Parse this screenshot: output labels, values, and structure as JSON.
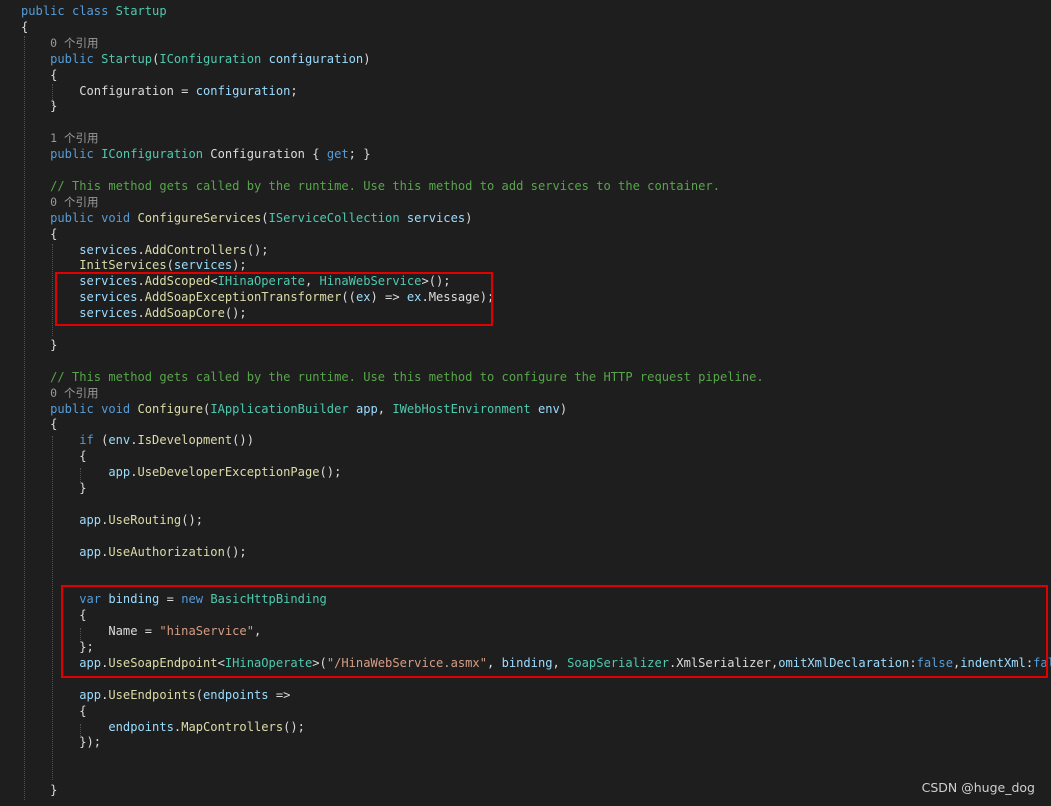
{
  "code_lines": [
    {
      "indent": "",
      "tokens": [
        {
          "t": "public",
          "c": "kw"
        },
        {
          "t": " ",
          "c": "pl"
        },
        {
          "t": "class",
          "c": "kw"
        },
        {
          "t": " ",
          "c": "pl"
        },
        {
          "t": "Startup",
          "c": "ty"
        }
      ]
    },
    {
      "indent": "",
      "tokens": [
        {
          "t": "{",
          "c": "pl"
        }
      ]
    },
    {
      "indent": "    ",
      "lens": "0 个引用"
    },
    {
      "indent": "    ",
      "tokens": [
        {
          "t": "public",
          "c": "kw"
        },
        {
          "t": " ",
          "c": "pl"
        },
        {
          "t": "Startup",
          "c": "ty"
        },
        {
          "t": "(",
          "c": "pl"
        },
        {
          "t": "IConfiguration",
          "c": "ty"
        },
        {
          "t": " ",
          "c": "pl"
        },
        {
          "t": "configuration",
          "c": "pa"
        },
        {
          "t": ")",
          "c": "pl"
        }
      ]
    },
    {
      "indent": "    ",
      "tokens": [
        {
          "t": "{",
          "c": "pl"
        }
      ]
    },
    {
      "indent": "        ",
      "tokens": [
        {
          "t": "Configuration",
          "c": "pl"
        },
        {
          "t": " = ",
          "c": "pl"
        },
        {
          "t": "configuration",
          "c": "pa"
        },
        {
          "t": ";",
          "c": "pl"
        }
      ]
    },
    {
      "indent": "    ",
      "tokens": [
        {
          "t": "}",
          "c": "pl"
        }
      ]
    },
    {
      "indent": "",
      "tokens": []
    },
    {
      "indent": "    ",
      "lens": "1 个引用"
    },
    {
      "indent": "    ",
      "tokens": [
        {
          "t": "public",
          "c": "kw"
        },
        {
          "t": " ",
          "c": "pl"
        },
        {
          "t": "IConfiguration",
          "c": "ty"
        },
        {
          "t": " Configuration { ",
          "c": "pl"
        },
        {
          "t": "get",
          "c": "kw"
        },
        {
          "t": "; }",
          "c": "pl"
        }
      ]
    },
    {
      "indent": "",
      "tokens": []
    },
    {
      "indent": "    ",
      "tokens": [
        {
          "t": "// This method gets called by the runtime. Use this method to add services to the container.",
          "c": "cm"
        }
      ]
    },
    {
      "indent": "    ",
      "lens": "0 个引用"
    },
    {
      "indent": "    ",
      "tokens": [
        {
          "t": "public",
          "c": "kw"
        },
        {
          "t": " ",
          "c": "pl"
        },
        {
          "t": "void",
          "c": "kw"
        },
        {
          "t": " ",
          "c": "pl"
        },
        {
          "t": "ConfigureServices",
          "c": "me"
        },
        {
          "t": "(",
          "c": "pl"
        },
        {
          "t": "IServiceCollection",
          "c": "ty"
        },
        {
          "t": " ",
          "c": "pl"
        },
        {
          "t": "services",
          "c": "pa"
        },
        {
          "t": ")",
          "c": "pl"
        }
      ]
    },
    {
      "indent": "    ",
      "tokens": [
        {
          "t": "{",
          "c": "pl"
        }
      ]
    },
    {
      "indent": "        ",
      "tokens": [
        {
          "t": "services",
          "c": "pa"
        },
        {
          "t": ".",
          "c": "pl"
        },
        {
          "t": "AddControllers",
          "c": "me"
        },
        {
          "t": "();",
          "c": "pl"
        }
      ]
    },
    {
      "indent": "        ",
      "tokens": [
        {
          "t": "InitServices",
          "c": "me"
        },
        {
          "t": "(",
          "c": "pl"
        },
        {
          "t": "services",
          "c": "pa"
        },
        {
          "t": ");",
          "c": "pl"
        }
      ]
    },
    {
      "indent": "        ",
      "tokens": [
        {
          "t": "services",
          "c": "pa"
        },
        {
          "t": ".",
          "c": "pl"
        },
        {
          "t": "AddScoped",
          "c": "me"
        },
        {
          "t": "<",
          "c": "pl"
        },
        {
          "t": "IHinaOperate",
          "c": "ty"
        },
        {
          "t": ", ",
          "c": "pl"
        },
        {
          "t": "HinaWebService",
          "c": "ty"
        },
        {
          "t": ">();",
          "c": "pl"
        }
      ]
    },
    {
      "indent": "        ",
      "tokens": [
        {
          "t": "services",
          "c": "pa"
        },
        {
          "t": ".",
          "c": "pl"
        },
        {
          "t": "AddSoapExceptionTransformer",
          "c": "me"
        },
        {
          "t": "((",
          "c": "pl"
        },
        {
          "t": "ex",
          "c": "pa"
        },
        {
          "t": ") => ",
          "c": "pl"
        },
        {
          "t": "ex",
          "c": "pa"
        },
        {
          "t": ".Message);",
          "c": "pl"
        }
      ]
    },
    {
      "indent": "        ",
      "tokens": [
        {
          "t": "services",
          "c": "pa"
        },
        {
          "t": ".",
          "c": "pl"
        },
        {
          "t": "AddSoapCore",
          "c": "me"
        },
        {
          "t": "();",
          "c": "pl"
        }
      ]
    },
    {
      "indent": "",
      "tokens": []
    },
    {
      "indent": "    ",
      "tokens": [
        {
          "t": "}",
          "c": "pl"
        }
      ]
    },
    {
      "indent": "",
      "tokens": []
    },
    {
      "indent": "    ",
      "tokens": [
        {
          "t": "// This method gets called by the runtime. Use this method to configure the HTTP request pipeline.",
          "c": "cm"
        }
      ]
    },
    {
      "indent": "    ",
      "lens": "0 个引用"
    },
    {
      "indent": "    ",
      "tokens": [
        {
          "t": "public",
          "c": "kw"
        },
        {
          "t": " ",
          "c": "pl"
        },
        {
          "t": "void",
          "c": "kw"
        },
        {
          "t": " ",
          "c": "pl"
        },
        {
          "t": "Configure",
          "c": "me"
        },
        {
          "t": "(",
          "c": "pl"
        },
        {
          "t": "IApplicationBuilder",
          "c": "ty"
        },
        {
          "t": " ",
          "c": "pl"
        },
        {
          "t": "app",
          "c": "pa"
        },
        {
          "t": ", ",
          "c": "pl"
        },
        {
          "t": "IWebHostEnvironment",
          "c": "ty"
        },
        {
          "t": " ",
          "c": "pl"
        },
        {
          "t": "env",
          "c": "pa"
        },
        {
          "t": ")",
          "c": "pl"
        }
      ]
    },
    {
      "indent": "    ",
      "tokens": [
        {
          "t": "{",
          "c": "pl"
        }
      ]
    },
    {
      "indent": "        ",
      "tokens": [
        {
          "t": "if",
          "c": "kw"
        },
        {
          "t": " (",
          "c": "pl"
        },
        {
          "t": "env",
          "c": "pa"
        },
        {
          "t": ".",
          "c": "pl"
        },
        {
          "t": "IsDevelopment",
          "c": "me"
        },
        {
          "t": "())",
          "c": "pl"
        }
      ]
    },
    {
      "indent": "        ",
      "tokens": [
        {
          "t": "{",
          "c": "pl"
        }
      ]
    },
    {
      "indent": "            ",
      "tokens": [
        {
          "t": "app",
          "c": "pa"
        },
        {
          "t": ".",
          "c": "pl"
        },
        {
          "t": "UseDeveloperExceptionPage",
          "c": "me"
        },
        {
          "t": "();",
          "c": "pl"
        }
      ]
    },
    {
      "indent": "        ",
      "tokens": [
        {
          "t": "}",
          "c": "pl"
        }
      ]
    },
    {
      "indent": "",
      "tokens": []
    },
    {
      "indent": "        ",
      "tokens": [
        {
          "t": "app",
          "c": "pa"
        },
        {
          "t": ".",
          "c": "pl"
        },
        {
          "t": "UseRouting",
          "c": "me"
        },
        {
          "t": "();",
          "c": "pl"
        }
      ]
    },
    {
      "indent": "",
      "tokens": []
    },
    {
      "indent": "        ",
      "tokens": [
        {
          "t": "app",
          "c": "pa"
        },
        {
          "t": ".",
          "c": "pl"
        },
        {
          "t": "UseAuthorization",
          "c": "me"
        },
        {
          "t": "();",
          "c": "pl"
        }
      ]
    },
    {
      "indent": "",
      "tokens": []
    },
    {
      "indent": "",
      "tokens": []
    },
    {
      "indent": "        ",
      "tokens": [
        {
          "t": "var",
          "c": "kw"
        },
        {
          "t": " ",
          "c": "pl"
        },
        {
          "t": "binding",
          "c": "pa"
        },
        {
          "t": " = ",
          "c": "pl"
        },
        {
          "t": "new",
          "c": "kw"
        },
        {
          "t": " ",
          "c": "pl"
        },
        {
          "t": "BasicHttpBinding",
          "c": "ty"
        }
      ]
    },
    {
      "indent": "        ",
      "tokens": [
        {
          "t": "{",
          "c": "pl"
        }
      ]
    },
    {
      "indent": "            ",
      "tokens": [
        {
          "t": "Name = ",
          "c": "pl"
        },
        {
          "t": "\"hinaService\"",
          "c": "st"
        },
        {
          "t": ",",
          "c": "pl"
        }
      ]
    },
    {
      "indent": "        ",
      "tokens": [
        {
          "t": "};",
          "c": "pl"
        }
      ]
    },
    {
      "indent": "        ",
      "tokens": [
        {
          "t": "app",
          "c": "pa"
        },
        {
          "t": ".",
          "c": "pl"
        },
        {
          "t": "UseSoapEndpoint",
          "c": "me"
        },
        {
          "t": "<",
          "c": "pl"
        },
        {
          "t": "IHinaOperate",
          "c": "ty"
        },
        {
          "t": ">(",
          "c": "pl"
        },
        {
          "t": "\"/HinaWebService.asmx\"",
          "c": "st"
        },
        {
          "t": ", ",
          "c": "pl"
        },
        {
          "t": "binding",
          "c": "pa"
        },
        {
          "t": ", ",
          "c": "pl"
        },
        {
          "t": "SoapSerializer",
          "c": "ty"
        },
        {
          "t": ".XmlSerializer,",
          "c": "pl"
        },
        {
          "t": "omitXmlDeclaration",
          "c": "pa"
        },
        {
          "t": ":",
          "c": "pl"
        },
        {
          "t": "false",
          "c": "kw"
        },
        {
          "t": ",",
          "c": "pl"
        },
        {
          "t": "indentXml",
          "c": "pa"
        },
        {
          "t": ":",
          "c": "pl"
        },
        {
          "t": "false",
          "c": "kw"
        },
        {
          "t": ");",
          "c": "pl"
        }
      ]
    },
    {
      "indent": "",
      "tokens": []
    },
    {
      "indent": "        ",
      "tokens": [
        {
          "t": "app",
          "c": "pa"
        },
        {
          "t": ".",
          "c": "pl"
        },
        {
          "t": "UseEndpoints",
          "c": "me"
        },
        {
          "t": "(",
          "c": "pl"
        },
        {
          "t": "endpoints",
          "c": "pa"
        },
        {
          "t": " =>",
          "c": "pl"
        }
      ]
    },
    {
      "indent": "        ",
      "tokens": [
        {
          "t": "{",
          "c": "pl"
        }
      ]
    },
    {
      "indent": "            ",
      "tokens": [
        {
          "t": "endpoints",
          "c": "pa"
        },
        {
          "t": ".",
          "c": "pl"
        },
        {
          "t": "MapControllers",
          "c": "me"
        },
        {
          "t": "();",
          "c": "pl"
        }
      ]
    },
    {
      "indent": "        ",
      "tokens": [
        {
          "t": "});",
          "c": "pl"
        }
      ]
    },
    {
      "indent": "",
      "tokens": []
    },
    {
      "indent": "",
      "tokens": []
    },
    {
      "indent": "    ",
      "tokens": [
        {
          "t": "}",
          "c": "pl"
        }
      ]
    }
  ],
  "watermark": "CSDN @huge_dog",
  "colors": {
    "background": "#1e1e1e",
    "keyword": "#569cd6",
    "type": "#4ec9b0",
    "method": "#dcdcaa",
    "parameter": "#9cdcfe",
    "string": "#d69d85",
    "comment": "#57a64a",
    "plain": "#dcdcdc",
    "highlight_box": "#e00000"
  }
}
